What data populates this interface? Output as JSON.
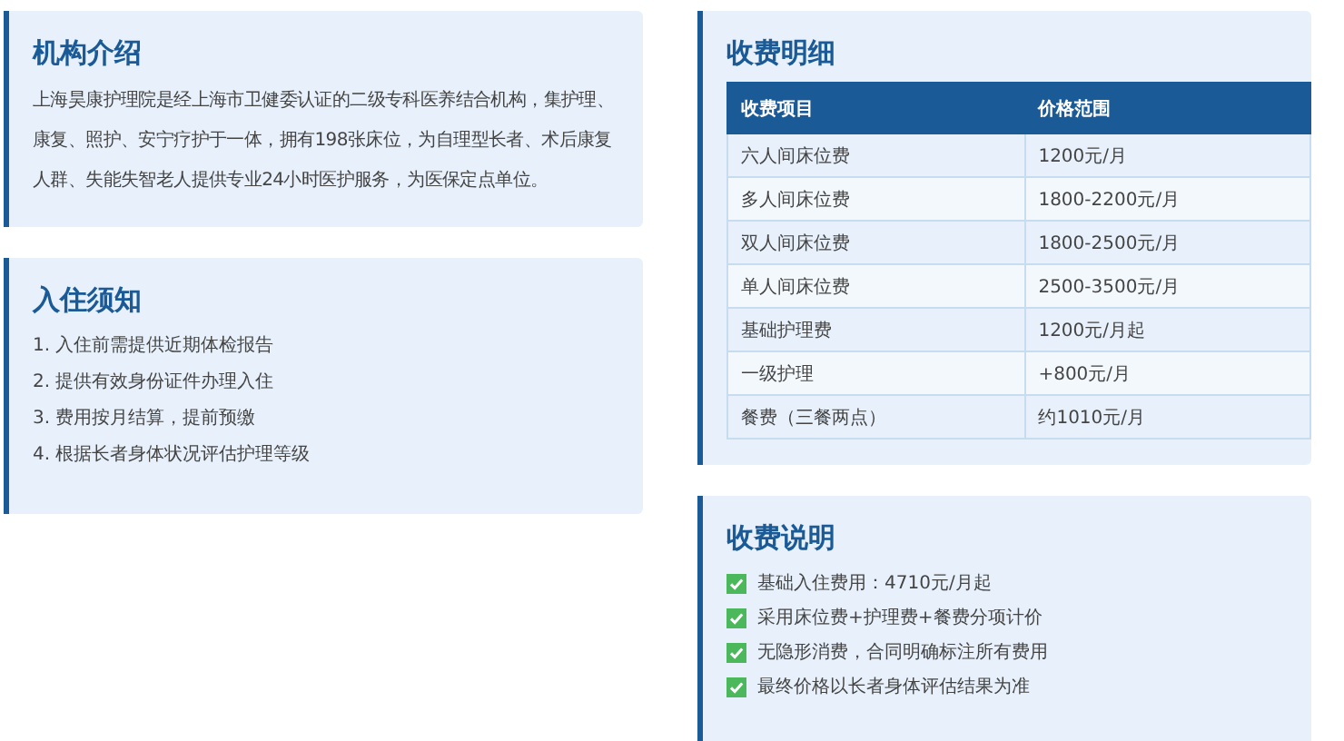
{
  "intro": {
    "title": "机构介绍",
    "text": "上海昊康护理院是经上海市卫健委认证的二级专科医养结合机构，集护理、康复、照护、安宁疗护于一体，拥有198张床位，为自理型长者、术后康复人群、失能失智老人提供专业24小时医护服务，为医保定点单位。"
  },
  "notice": {
    "title": "入住须知",
    "items": [
      "1. 入住前需提供近期体检报告",
      "2. 提供有效身份证件办理入住",
      "3. 费用按月结算，提前预缴",
      "4. 根据长者身体状况评估护理等级"
    ]
  },
  "fees": {
    "title": "收费明细",
    "table": {
      "columns": [
        "收费项目",
        "价格范围"
      ],
      "rows": [
        [
          "六人间床位费",
          "1200元/月"
        ],
        [
          "多人间床位费",
          "1800-2200元/月"
        ],
        [
          "双人间床位费",
          "1800-2500元/月"
        ],
        [
          "单人间床位费",
          "2500-3500元/月"
        ],
        [
          "基础护理费",
          "1200元/月起"
        ],
        [
          "一级护理",
          "+800元/月"
        ],
        [
          "餐费（三餐两点）",
          "约1010元/月"
        ]
      ]
    }
  },
  "notes": {
    "title": "收费说明",
    "items": [
      {
        "text": "基础入住费用：4710元/月起",
        "checked": true
      },
      {
        "text": "采用床位费+护理费+餐费分项计价",
        "checked": true
      },
      {
        "text": "无隐形消费，合同明确标注所有费用",
        "checked": true
      },
      {
        "text": "最终价格以长者身体评估结果为准",
        "checked": true
      }
    ]
  }
}
